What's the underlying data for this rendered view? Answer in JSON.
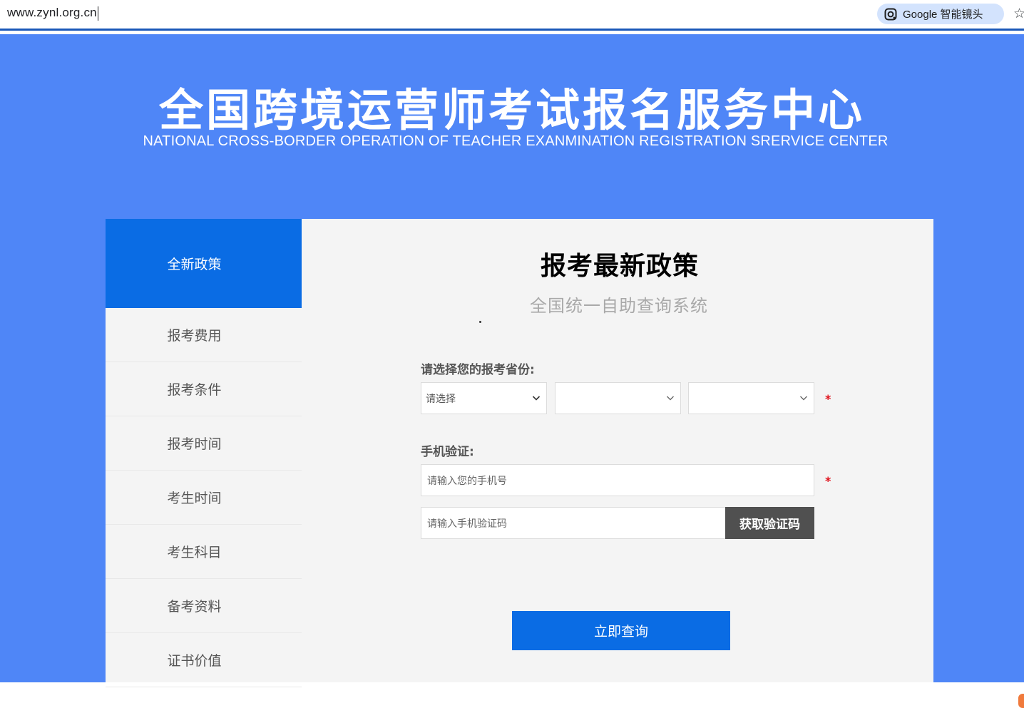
{
  "browser": {
    "url": "www.zynl.org.cn",
    "lens_label": "Google 智能镜头"
  },
  "header": {
    "title": "全国跨境运营师考试报名服务中心",
    "subtitle": "NATIONAL CROSS-BORDER OPERATION OF TEACHER EXANMINATION REGISTRATION SRERVICE CENTER"
  },
  "sidebar": {
    "items": [
      {
        "label": "全新政策",
        "active": true
      },
      {
        "label": "报考费用"
      },
      {
        "label": "报考条件"
      },
      {
        "label": "报考时间"
      },
      {
        "label": "考生时间"
      },
      {
        "label": "考生科目"
      },
      {
        "label": "备考资料"
      },
      {
        "label": "证书价值"
      }
    ]
  },
  "main": {
    "title": "报考最新政策",
    "subtitle": "全国统一自助查询系统",
    "province_label": "请选择您的报考省份:",
    "province_select_1": "请选择",
    "province_select_2": "",
    "province_select_3": "",
    "phone_label": "手机验证:",
    "phone_placeholder": "请输入您的手机号",
    "code_placeholder": "请输入手机验证码",
    "get_code_button": "获取验证码",
    "required_mark": "*",
    "submit_button": "立即查询"
  },
  "colors": {
    "page_bg": "#4f86f7",
    "accent_blue": "#0a6ce4",
    "panel_bg": "#f4f4f4",
    "dark_button": "#505050",
    "required_red": "#e0101a"
  },
  "icons": [
    "google-lens-icon",
    "bookmark-star-icon",
    "chevron-down-icon"
  ]
}
